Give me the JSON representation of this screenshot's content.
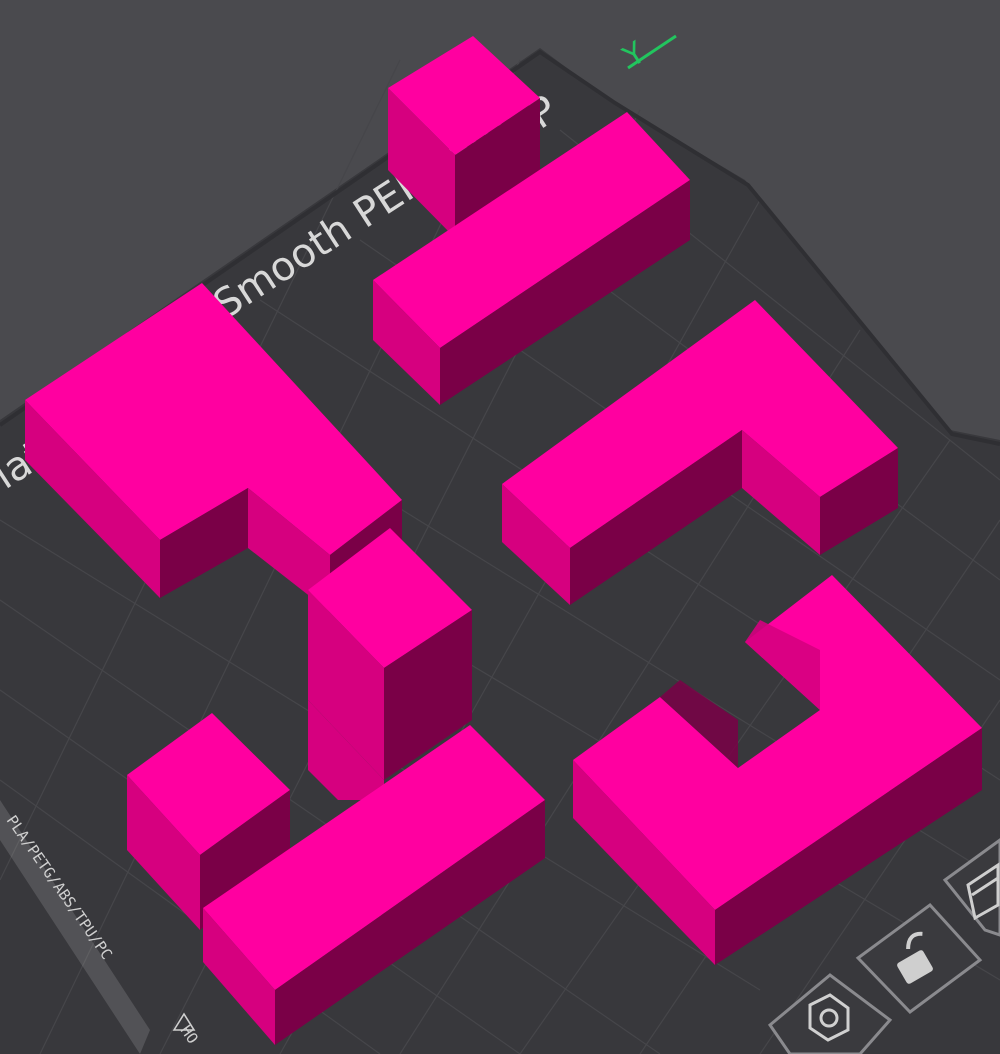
{
  "bed": {
    "plate_label": "Smooth PEI Plate",
    "plate_label_fragment_top": "P",
    "plate_label_fragment_left": "late",
    "filament_label": "PLA/PETG/ABS/TPU/PC",
    "warning_label": "HO",
    "axis_y_label": "Y",
    "icon_lock": "lock-icon",
    "icon_orient": "orient-icon",
    "icon_layout": "layout-icon"
  },
  "colors": {
    "background": "#4a4a4e",
    "plate": "#38383c",
    "plate_grid": "#46464a",
    "object_top": "#ff00a0",
    "object_side_light": "#d6007f",
    "object_side_dark": "#7a0047",
    "axis_y": "#22c55e"
  }
}
